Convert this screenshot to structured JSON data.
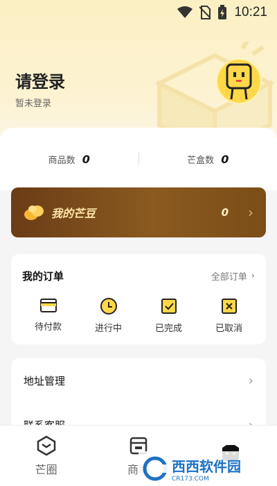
{
  "status_bar": {
    "time": "10:21",
    "icons": [
      "wifi-icon",
      "no-sim-icon",
      "battery-charging-icon"
    ]
  },
  "profile": {
    "title": "请登录",
    "subtitle": "暂未登录",
    "avatar_icon": "mascot-avatar-icon"
  },
  "stats": [
    {
      "label": "商品数",
      "value": "0"
    },
    {
      "label": "芒盒数",
      "value": "0"
    }
  ],
  "beans": {
    "label": "我的芒豆",
    "value": "0",
    "icon": "beans-icon"
  },
  "orders": {
    "title": "我的订单",
    "all_label": "全部订单",
    "items": [
      {
        "label": "待付款",
        "icon": "wallet-icon"
      },
      {
        "label": "进行中",
        "icon": "clock-icon"
      },
      {
        "label": "已完成",
        "icon": "check-box-icon"
      },
      {
        "label": "已取消",
        "icon": "cancel-box-icon"
      }
    ]
  },
  "menu": [
    {
      "label": "地址管理"
    },
    {
      "label": "联系客服"
    }
  ],
  "tabs": [
    {
      "label": "芒圈",
      "icon": "box-hexagon-icon"
    },
    {
      "label": "商城",
      "icon": "store-icon"
    },
    {
      "label": "",
      "icon": "mascot-tab-icon"
    }
  ],
  "watermark": {
    "text": "西西软件园",
    "sub": "CR173.COM"
  },
  "colors": {
    "accent": "#ffd84a",
    "beans_bg": "#7a4a1a",
    "page_bg": "#f5f5f5"
  }
}
